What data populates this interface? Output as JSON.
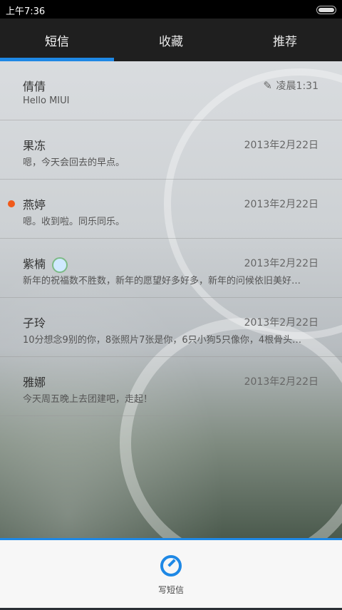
{
  "status_bar": {
    "time": "上午7:36"
  },
  "tabs": [
    {
      "label": "短信"
    },
    {
      "label": "收藏"
    },
    {
      "label": "推荐"
    }
  ],
  "messages": [
    {
      "name": "倩倩",
      "preview": "Hello MIUI",
      "date": "凌晨1:31",
      "draft": true,
      "unread": false
    },
    {
      "name": "果冻",
      "preview": "嗯，今天会回去的早点。",
      "date": "2013年2月22日",
      "unread": false
    },
    {
      "name": "燕婷",
      "preview": "嗯。收到啦。同乐同乐。",
      "date": "2013年2月22日",
      "unread": true
    },
    {
      "name": "紫楠",
      "preview": "新年的祝福数不胜数，新年的愿望好多好多，新年的问候依旧美好…",
      "date": "2013年2月22日",
      "unread": false,
      "emoji": true
    },
    {
      "name": "子玲",
      "preview": "10分想念9别的你，8张照片7张是你，6只小狗5只像你，4根骨头…",
      "date": "2013年2月22日",
      "unread": false
    },
    {
      "name": "雅娜",
      "preview": "今天周五晚上去团建吧，走起！",
      "date": "2013年2月22日",
      "unread": false
    }
  ],
  "bottom": {
    "compose_label": "写短信"
  },
  "colors": {
    "accent": "#1e88e5",
    "unread": "#f05a1a"
  }
}
